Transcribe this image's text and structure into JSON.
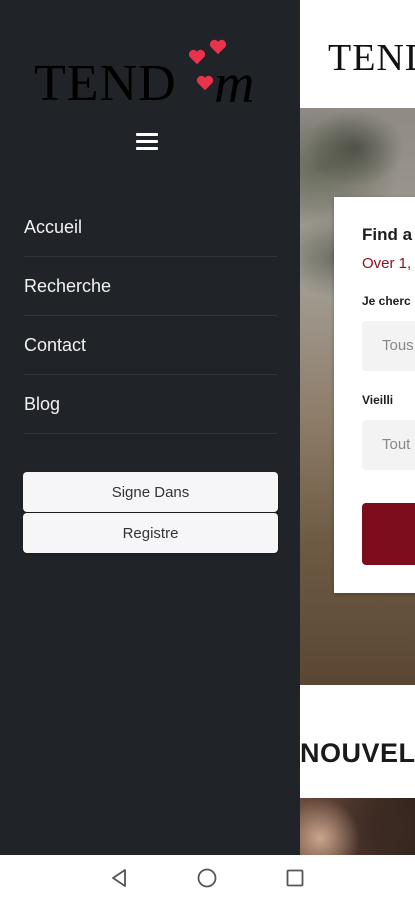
{
  "app": {
    "logo_text": "TEND",
    "logo_script": "m"
  },
  "page": {
    "header_logo": "TEND",
    "search_card": {
      "title": "Find a",
      "subtitle": "Over 1,",
      "field1_label": "Je cherc",
      "field1_value": "Tous",
      "field2_label": "Vieilli",
      "field2_value": "Tout"
    },
    "section_title": "NOUVEL"
  },
  "drawer": {
    "nav_items": [
      {
        "label": "Accueil"
      },
      {
        "label": "Recherche"
      },
      {
        "label": "Contact"
      },
      {
        "label": "Blog"
      }
    ],
    "sign_in_label": "Signe Dans",
    "register_label": "Registre"
  },
  "icons": {
    "menu": "hamburger-icon",
    "hearts": "heart-icon",
    "back": "back-triangle-icon",
    "home": "home-circle-icon",
    "recents": "recents-square-icon"
  },
  "colors": {
    "drawer_bg": "#202328",
    "accent_red": "#7d0c1c",
    "heart": "#e8334a"
  }
}
